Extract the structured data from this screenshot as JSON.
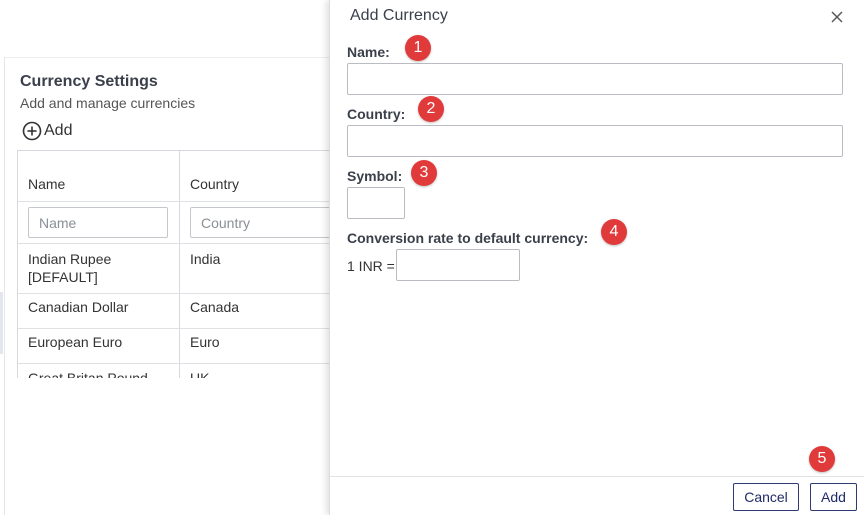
{
  "background": {
    "title": "Currency Settings",
    "subtitle": "Add and manage currencies",
    "add_label": "Add",
    "columns": [
      "Name",
      "Country"
    ],
    "filters": {
      "name_placeholder": "Name",
      "country_placeholder": "Country"
    },
    "rows": [
      {
        "name_line1": "Indian Rupee",
        "name_line2": "[DEFAULT]",
        "country": "India"
      },
      {
        "name_line1": "Canadian Dollar",
        "name_line2": "",
        "country": "Canada"
      },
      {
        "name_line1": "European Euro",
        "name_line2": "",
        "country": "Euro"
      },
      {
        "name_line1": "Great Britan Pound",
        "name_line2": "",
        "country": "UK"
      }
    ]
  },
  "dialog": {
    "title": "Add Currency",
    "fields": {
      "name_label": "Name:",
      "country_label": "Country:",
      "symbol_label": "Symbol:",
      "rate_label": "Conversion rate to default currency:",
      "rate_prefix": "1 INR ="
    },
    "values": {
      "name": "",
      "country": "",
      "symbol": "",
      "rate": ""
    },
    "buttons": {
      "cancel": "Cancel",
      "add": "Add"
    }
  },
  "callouts": [
    "1",
    "2",
    "3",
    "4",
    "5"
  ],
  "colors": {
    "callout": "#e03a3a",
    "button_border": "#2e3a75"
  }
}
